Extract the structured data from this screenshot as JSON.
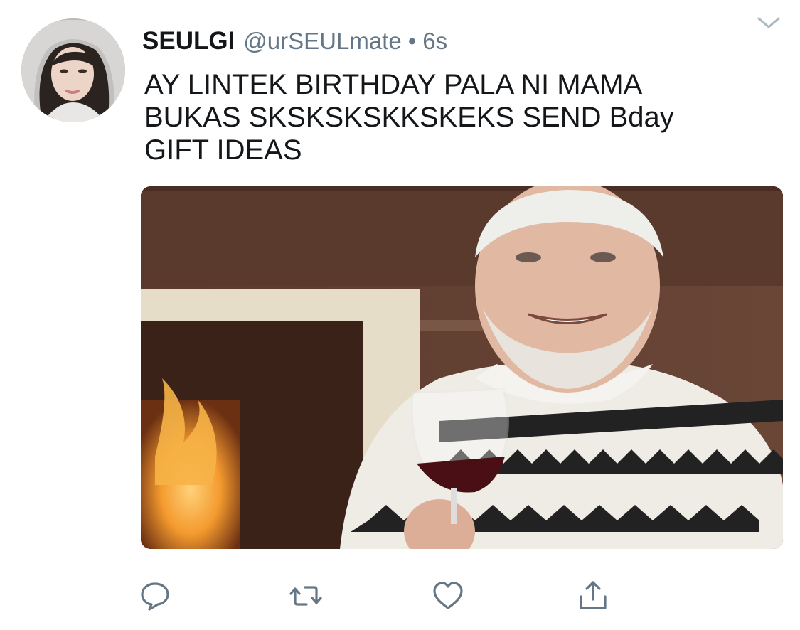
{
  "tweet": {
    "display_name": "SEULGI",
    "handle": "@urSEULmate",
    "separator": "•",
    "time": "6s",
    "lines": [
      "AY LINTEK BIRTHDAY PALA NI MAMA",
      "BUKAS SKSKSKSKKSKEKS SEND Bday",
      "GIFT IDEAS"
    ]
  },
  "icons": {
    "avatar": "profile-photo",
    "caret": "chevron-down-icon",
    "reply": "speech-bubble-icon",
    "retweet": "retweet-arrows-icon",
    "like": "heart-icon",
    "share": "share-upload-icon"
  },
  "colors": {
    "text": "#14171a",
    "secondary": "#657786",
    "icon": "#657786"
  }
}
